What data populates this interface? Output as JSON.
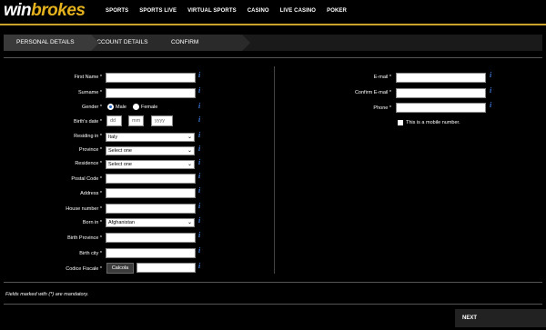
{
  "brand": {
    "prefix": "win",
    "suffix": "brokes"
  },
  "nav": [
    "SPORTS",
    "SPORTS LIVE",
    "VIRTUAL SPORTS",
    "CASINO",
    "LIVE CASINO",
    "POKER"
  ],
  "steps": [
    "PERSONAL DETAILS",
    "ACCOUNT DETAILS",
    "CONFIRM"
  ],
  "left_form": {
    "first_name": "First Name *",
    "surname": "Surname *",
    "gender": "Gender *",
    "gender_male": "Male",
    "gender_female": "Female",
    "birth_date": "Birth's date *",
    "dd": "dd",
    "mm": "mm",
    "yyyy": "yyyy",
    "residing_in": "Residing in *",
    "residing_value": "Italy",
    "province": "Province *",
    "province_value": "Select one",
    "residence": "Residence *",
    "residence_value": "Select one",
    "postal_code": "Postal Code *",
    "address": "Address *",
    "house_number": "House number *",
    "born_in": "Born in *",
    "born_in_value": "Afghanistan",
    "birth_province": "Birth Province *",
    "birth_city": "Birth city *",
    "codice_fiscale": "Codice Fiscale *",
    "calcola": "Calcola"
  },
  "right_form": {
    "email": "E-mail *",
    "confirm_email": "Confirm E-mail *",
    "phone": "Phone *",
    "mobile_checkbox": "This is a mobile number."
  },
  "info_icon": "i",
  "footer_note": "Fields marked with (*) are mandatory.",
  "next_button": "NEXT",
  "colors": {
    "accent_gold": "#e5b21e",
    "info_blue": "#3b7ad8",
    "background": "#000000"
  }
}
